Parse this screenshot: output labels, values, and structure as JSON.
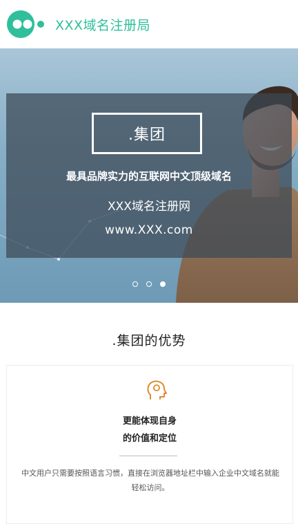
{
  "header": {
    "brand": "XXX域名注册局",
    "logo_icon": "logo-dots-icon",
    "accent": "#2fbf9a"
  },
  "hero": {
    "badge": ".集团",
    "tagline": "最具品牌实力的互联网中文顶级域名",
    "site_name": "XXX域名注册网",
    "site_url": "www.XXX.com",
    "carousel": {
      "total": 3,
      "active": 3
    }
  },
  "advantages": {
    "title": ".集团的优势",
    "cards": [
      {
        "icon": "head-profile-icon",
        "title_line1": "更能体现自身",
        "title_line2": "的价值和定位",
        "description": "中文用户只需要按照语言习惯，直接在浏览器地址栏中输入企业中文域名就能轻松访问。"
      }
    ]
  },
  "colors": {
    "icon_orange": "#e08a2c",
    "overlay": "#3c4854"
  }
}
